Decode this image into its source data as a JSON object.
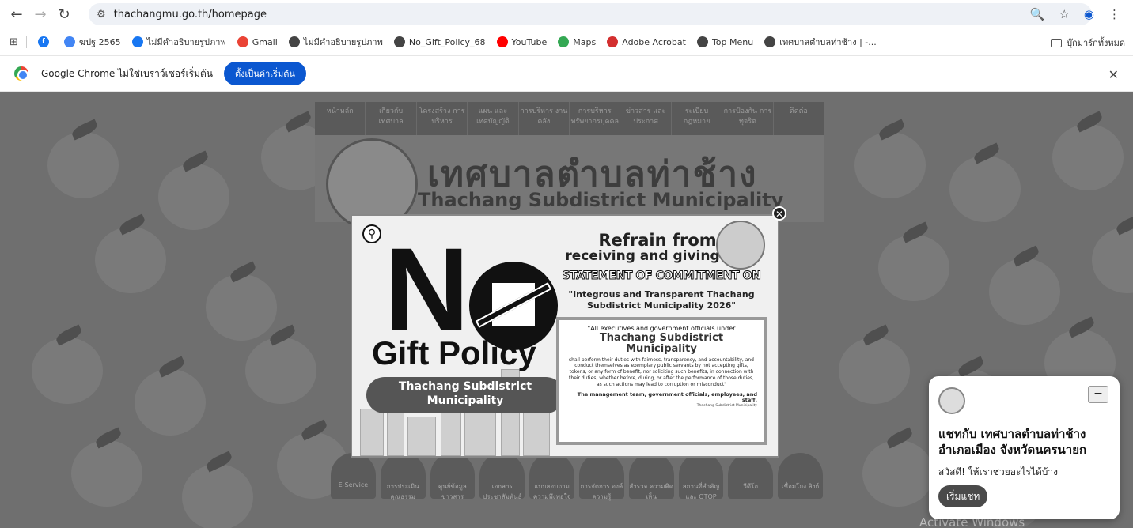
{
  "browser": {
    "url": "thachangmu.go.th/homepage",
    "bookmarks": [
      {
        "label": "ฆปฐ 2565",
        "icon": "google-icon",
        "color": "#4285f4"
      },
      {
        "label": "ไม่มีคำอธิบายรูปภาพ",
        "icon": "facebook-icon",
        "color": "#1877f2"
      },
      {
        "label": "Gmail",
        "icon": "gmail-icon",
        "color": "#ea4335"
      },
      {
        "label": "ไม่มีคำอธิบายรูปภาพ",
        "icon": "globe-icon",
        "color": "#444444"
      },
      {
        "label": "No_Gift_Policy_68",
        "icon": "globe-icon",
        "color": "#444444"
      },
      {
        "label": "YouTube",
        "icon": "youtube-icon",
        "color": "#ff0000"
      },
      {
        "label": "Maps",
        "icon": "maps-icon",
        "color": "#34a853"
      },
      {
        "label": "Adobe Acrobat",
        "icon": "acrobat-icon",
        "color": "#d32f2f"
      },
      {
        "label": "Top Menu",
        "icon": "globe-icon",
        "color": "#444444"
      },
      {
        "label": "เทศบาลตำบลท่าช้าง | -...",
        "icon": "globe-icon",
        "color": "#444444"
      }
    ],
    "all_bookmarks": "บุ๊กมาร์กทั้งหมด",
    "infobar_text": "Google Chrome ไม่ใช่เบราว์เซอร์เริ่มต้น",
    "infobar_button": "ตั้งเป็นค่าเริ่มต้น"
  },
  "site": {
    "nav": [
      "หน้าหลัก",
      "เกี่ยวกับ เทศบาล",
      "โครงสร้าง การบริหาร",
      "แผน และ เทศบัญญัติ",
      "การบริหาร งานคลัง",
      "การบริหาร ทรัพยากรบุคคล",
      "ข่าวสาร และ ประกาศ",
      "ระเบียบ กฎหมาย",
      "การป้องกัน การทุจริต",
      "ติดต่อ"
    ],
    "title_th": "เทศบาลตำบลท่าช้าง",
    "title_en": "Thachang Subdistrict Municipality",
    "services": [
      "E-Service",
      "การประเมิน คุณธรรม",
      "ศูนย์ข้อมูล ข่าวสาร",
      "เอกสาร ประชาสัมพันธ์",
      "แบบสอบถาม ความพึงพอใจ",
      "การจัดการ องค์ความรู้",
      "สำรวจ ความคิดเห็น",
      "สถานที่สำคัญ และ OTOP",
      "วีดีโอ",
      "เชื่อมโยง ลิงก์"
    ]
  },
  "modal": {
    "big_letter": "N",
    "gift_policy": "Gift Policy",
    "municipality": "Thachang Subdistrict Municipality",
    "refrain": "Refrain from",
    "receiving": "receiving and giving",
    "statement": "STATEMENT OF COMMITMENT ON",
    "integrous": "\"Integrous and Transparent Thachang Subdistrict Municipality 2026\"",
    "quote_intro": "\"All executives and government officials under",
    "quote_name": "Thachang Subdistrict Municipality",
    "quote_body": "shall perform their duties with fairness, transparency, and accountability, and conduct themselves as exemplary public servants by not accepting gifts, tokens, or any form of benefit, nor soliciting such benefits, in connection with their duties, whether before, during, or after the performance of those duties, as such actions may lead to corruption or misconduct\"",
    "signoff": "The management team, government officials, employees, and staff.",
    "signoff_org": "Thachang Subdistrict Municipality"
  },
  "chat": {
    "title": "แชทกับ เทศบาลตำบลท่าช้าง อำเภอเมือง จังหวัดนครนายก",
    "greeting": "สวัสดี! ให้เราช่วยอะไรได้บ้าง",
    "start_button": "เริ่มแชท"
  },
  "os": {
    "watermark": "Activate Windows"
  }
}
